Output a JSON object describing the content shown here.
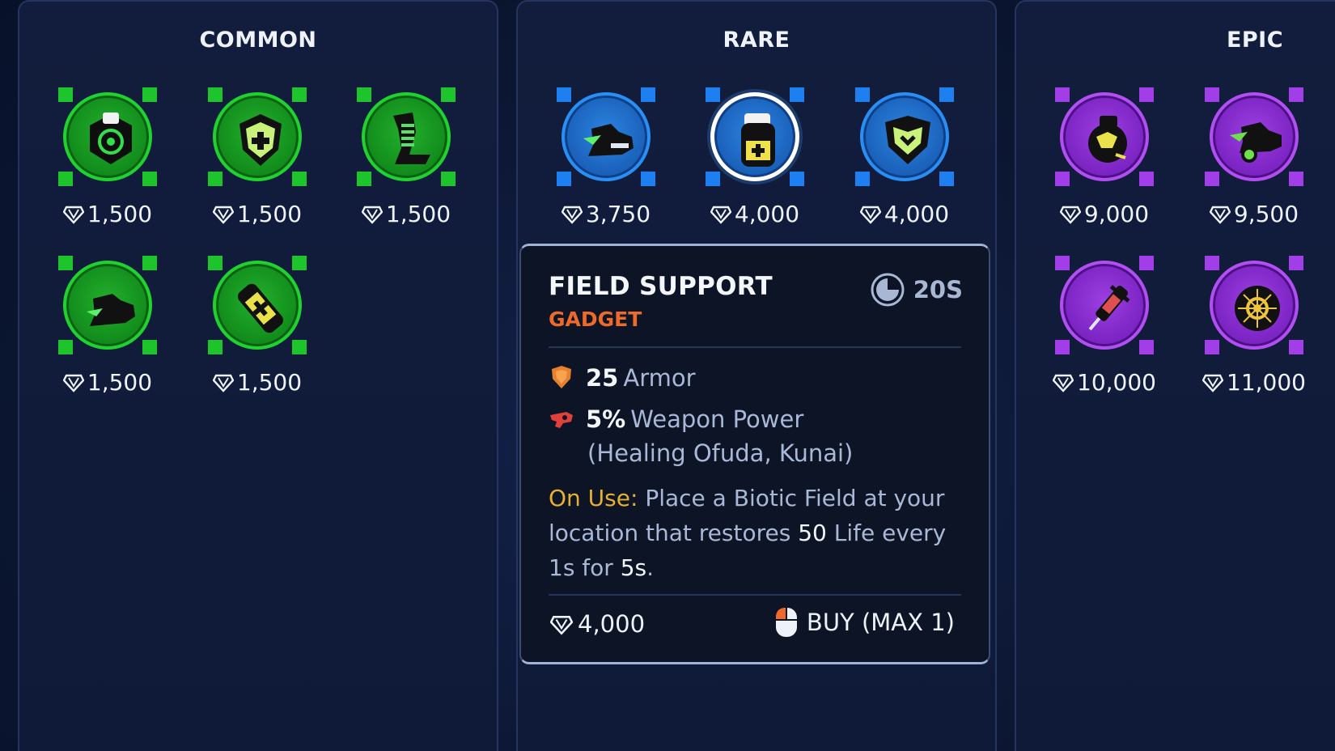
{
  "panels": {
    "common": {
      "title": "COMMON"
    },
    "rare": {
      "title": "RARE"
    },
    "epic": {
      "title": "EPIC"
    }
  },
  "items": {
    "common": [
      {
        "price": "1,500",
        "icon": "gadget-target-icon"
      },
      {
        "price": "1,500",
        "icon": "gadget-shield-plus-icon"
      },
      {
        "price": "1,500",
        "icon": "gadget-spring-boot-icon"
      },
      {
        "price": "1,500",
        "icon": "gadget-boot-icon"
      },
      {
        "price": "1,500",
        "icon": "gadget-battery-icon"
      }
    ],
    "rare": [
      {
        "price": "3,750",
        "icon": "gadget-speed-boot-icon"
      },
      {
        "price": "4,000",
        "icon": "gadget-field-support-icon",
        "selected": true
      },
      {
        "price": "4,000",
        "icon": "gadget-armor-icon"
      }
    ],
    "epic": [
      {
        "price": "9,000",
        "icon": "gadget-bomb-icon"
      },
      {
        "price": "9,500",
        "icon": "gadget-dash-boot-icon"
      },
      {
        "price": "10,000",
        "icon": "gadget-syringe-icon"
      },
      {
        "price": "11,000",
        "icon": "gadget-core-icon"
      }
    ]
  },
  "tooltip": {
    "name": "FIELD SUPPORT",
    "type": "GADGET",
    "cooldown": "20S",
    "stats": [
      {
        "value": "25",
        "label": "Armor",
        "icon": "armor-shield-icon"
      },
      {
        "value": "5%",
        "label": "Weapon Power",
        "icon": "weapon-power-icon",
        "detail": "(Healing Ofuda, Kunai)"
      }
    ],
    "description": {
      "label": "On Use:",
      "part1": " Place a Biotic Field at your location that restores ",
      "amount": "50",
      "part2": " Life every  1s for ",
      "duration": "5s",
      "part3": "."
    },
    "price": "4,000",
    "buy_label": "BUY (MAX 1)"
  },
  "colors": {
    "common": "#1ec42c",
    "rare": "#1e7ff0",
    "epic": "#a23ee8",
    "gadget_type": "#ee6a2a",
    "on_use": "#e6b030"
  }
}
